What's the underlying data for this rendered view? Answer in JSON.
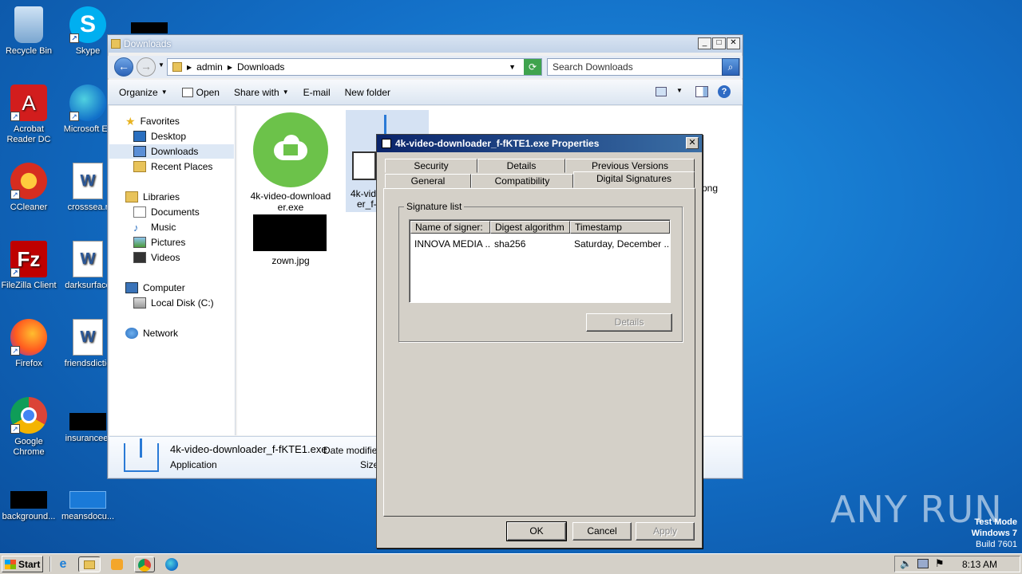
{
  "desktop": {
    "icons": [
      {
        "label": "Recycle Bin"
      },
      {
        "label": "Skype"
      },
      {
        "label": "Acrobat Reader DC"
      },
      {
        "label": "Microsoft Ec"
      },
      {
        "label": "CCleaner"
      },
      {
        "label": "crosssea.r"
      },
      {
        "label": "FileZilla Client"
      },
      {
        "label": "darksurface"
      },
      {
        "label": "Firefox"
      },
      {
        "label": "friendsdictio"
      },
      {
        "label": "Google Chrome"
      },
      {
        "label": "insurancee."
      },
      {
        "label": "background..."
      },
      {
        "label": "meansdocu..."
      }
    ]
  },
  "explorer": {
    "title": "Downloads",
    "breadcrumb": [
      "admin",
      "Downloads"
    ],
    "search_placeholder": "Search Downloads",
    "toolbar": {
      "organize": "Organize",
      "open": "Open",
      "share_with": "Share with",
      "email": "E-mail",
      "new_folder": "New folder"
    },
    "nav": {
      "favorites": "Favorites",
      "desktop": "Desktop",
      "downloads": "Downloads",
      "recent_places": "Recent Places",
      "libraries": "Libraries",
      "documents": "Documents",
      "music": "Music",
      "pictures": "Pictures",
      "videos": "Videos",
      "computer": "Computer",
      "local_disk": "Local Disk (C:)",
      "network": "Network"
    },
    "files": [
      {
        "name_line1": "4k-video-download",
        "name_line2": "er.exe"
      },
      {
        "name_line1": "4k-vide",
        "name_line2": "er_f-"
      },
      {
        "name_line1": "zown.jpg",
        "name_line2": ""
      },
      {
        "name_line1": "png",
        "name_line2": ""
      }
    ],
    "details": {
      "filename": "4k-video-downloader_f-fKTE1.exe",
      "type": "Application",
      "date_modified_label": "Date modified",
      "size_label": "Size"
    }
  },
  "dialog": {
    "title": "4k-video-downloader_f-fKTE1.exe Properties",
    "tabs_back": [
      "Security",
      "Details",
      "Previous Versions"
    ],
    "tabs_front": [
      "General",
      "Compatibility",
      "Digital Signatures"
    ],
    "active_tab": "Digital Signatures",
    "group_label": "Signature list",
    "columns": [
      "Name of signer:",
      "Digest algorithm",
      "Timestamp"
    ],
    "rows": [
      {
        "signer": "INNOVA MEDIA ...",
        "digest": "sha256",
        "timestamp": "Saturday, December ..."
      }
    ],
    "details_button": "Details",
    "ok": "OK",
    "cancel": "Cancel",
    "apply": "Apply"
  },
  "taskbar": {
    "start": "Start",
    "time": "8:13 AM"
  },
  "watermark": {
    "line1": "Test Mode",
    "line2": "Windows 7",
    "line3": "Build 7601",
    "brand": "ANY RUN"
  }
}
